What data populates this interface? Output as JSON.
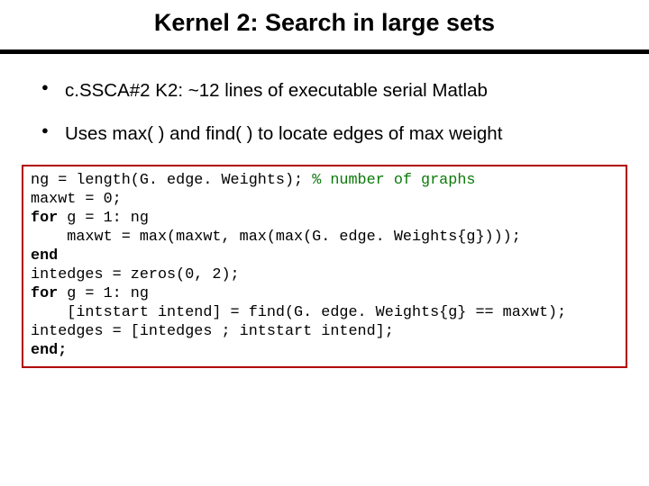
{
  "title": "Kernel 2: Search in large sets",
  "bullets": [
    "c.SSCA#2 K2:  ~12 lines of executable serial Matlab",
    "Uses max( ) and find( ) to locate edges of max weight"
  ],
  "code": {
    "l1a": "ng = length(G. edge. Weights); ",
    "l1b": "% number of graphs",
    "l2": "maxwt = 0;",
    "l3a": "for",
    "l3b": " g = 1: ng",
    "l4": "    maxwt = max(maxwt, max(max(G. edge. Weights{g})));",
    "l5": "end",
    "l6": "intedges = zeros(0, 2);",
    "l7a": "for",
    "l7b": " g = 1: ng",
    "l8": "    [intstart intend] = find(G. edge. Weights{g} == maxwt);",
    "l9": "intedges = [intedges ; intstart intend];",
    "l10": "end;"
  }
}
